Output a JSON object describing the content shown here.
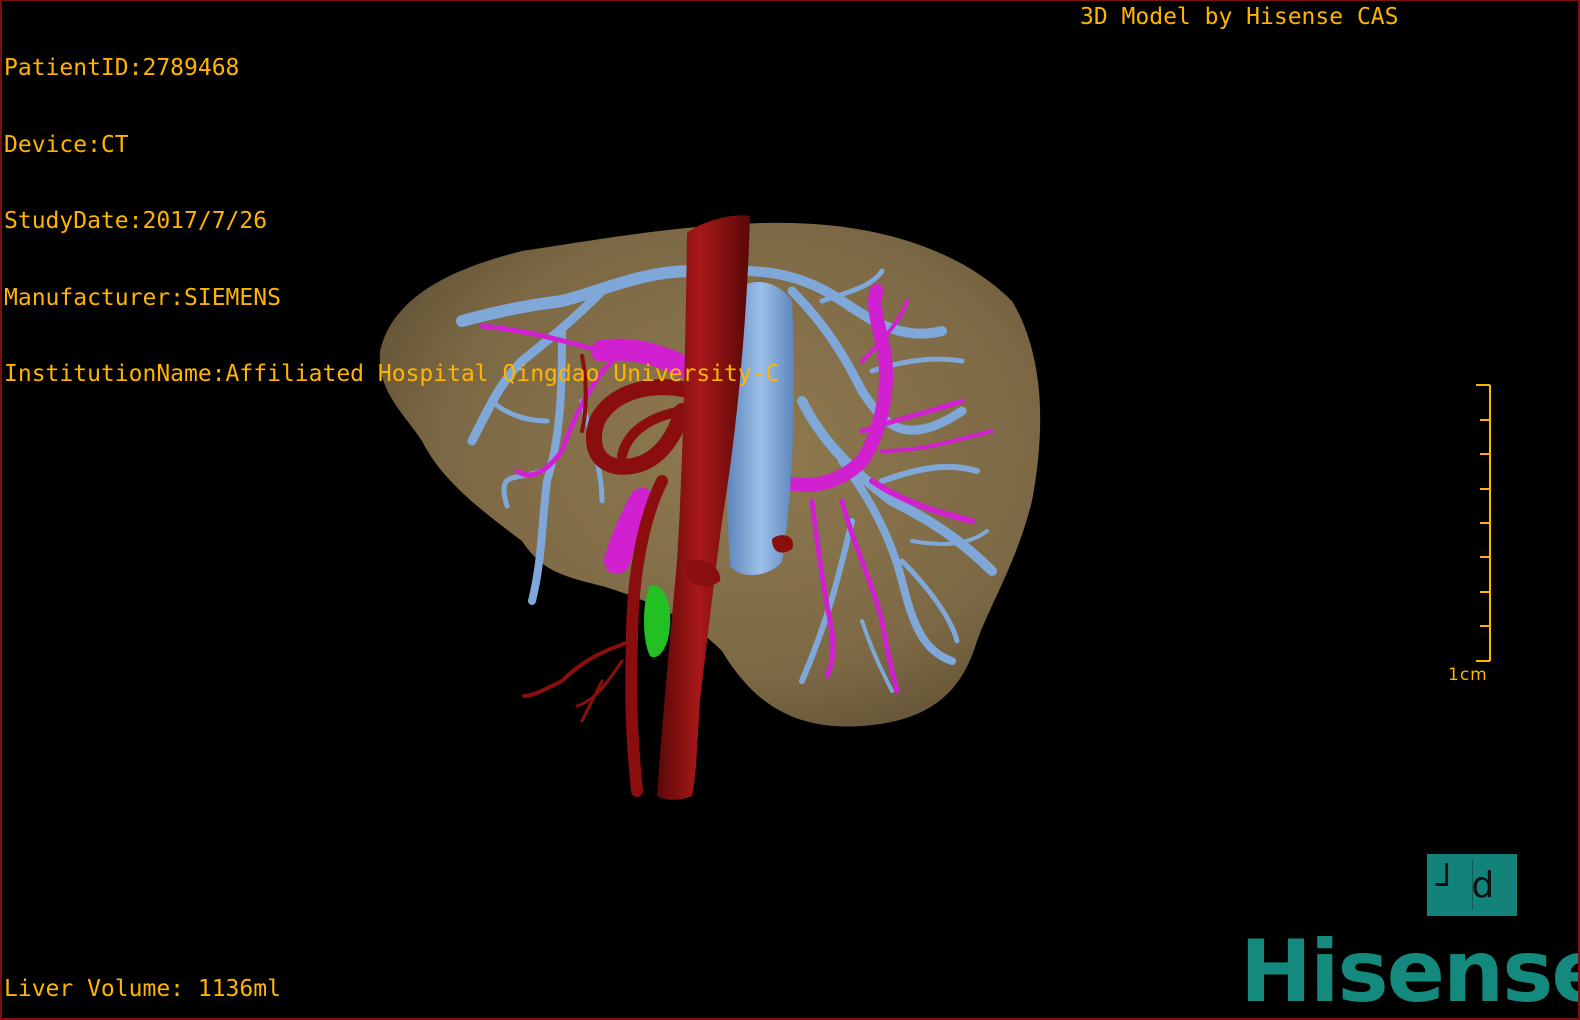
{
  "study_info": {
    "patient_id": "PatientID:2789468",
    "device": "Device:CT",
    "study_date": "StudyDate:2017/7/26",
    "manufacturer": "Manufacturer:SIEMENS",
    "institution": "InstitutionName:Affiliated Hospital Qingdao University-C"
  },
  "caption": "3D Model by Hisense CAS",
  "liver_volume": "Liver Volume: 1136ml",
  "scale_bar": {
    "label": "1cm",
    "ticks": 9
  },
  "orientation_cube": {
    "text": "┘d",
    "icon": "orientation-cube-icon"
  },
  "logo_text": "Hisense",
  "colors": {
    "text": "#ffb400",
    "liver": "#86704a",
    "hepatic_vein": "#7fa8d8",
    "portal_vein": "#d020d0",
    "artery_aorta": "#8b0e0e",
    "gallbladder": "#22c022",
    "brand": "#138a7d",
    "border": "#7a1010"
  }
}
